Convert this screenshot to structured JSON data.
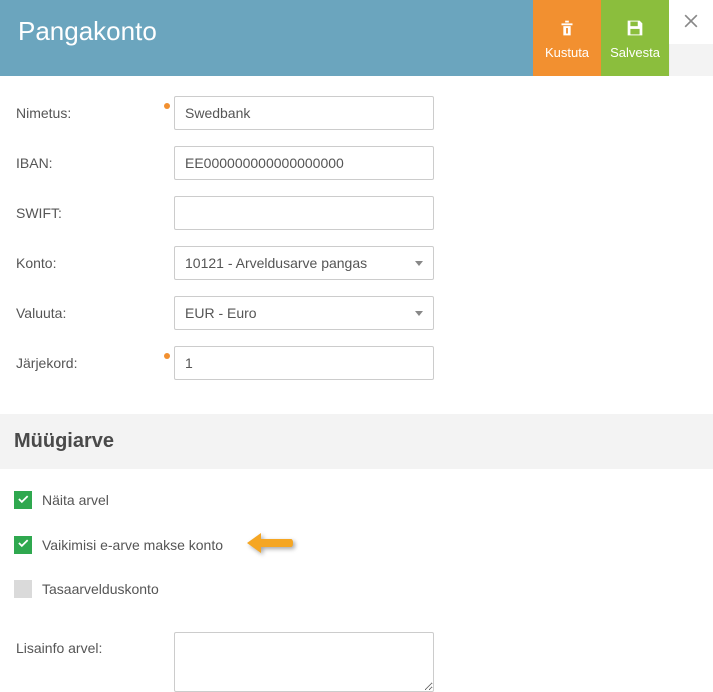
{
  "header": {
    "title": "Pangakonto",
    "delete_label": "Kustuta",
    "save_label": "Salvesta"
  },
  "fields": {
    "name_label": "Nimetus:",
    "name_value": "Swedbank",
    "iban_label": "IBAN:",
    "iban_value": "EE000000000000000000",
    "swift_label": "SWIFT:",
    "swift_value": "",
    "account_label": "Konto:",
    "account_value": "10121 - Arveldusarve pangas",
    "currency_label": "Valuuta:",
    "currency_value": "EUR - Euro",
    "order_label": "Järjekord:",
    "order_value": "1"
  },
  "section": {
    "sales_invoice_title": "Müügiarve"
  },
  "checkboxes": {
    "show_on_invoice": {
      "label": "Näita arvel",
      "checked": true
    },
    "default_einvoice": {
      "label": "Vaikimisi e-arve makse konto",
      "checked": true
    },
    "offset_account": {
      "label": "Tasaarvelduskonto",
      "checked": false
    }
  },
  "extra": {
    "info_label": "Lisainfo arvel:",
    "info_value": ""
  }
}
